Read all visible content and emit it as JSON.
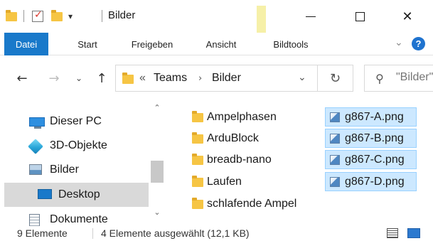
{
  "window": {
    "title": "Bilder",
    "contextual_tab_group": "Bildtools",
    "quick_access_dropdown": "▾",
    "controls": {
      "minimize": "—",
      "maximize": "☐",
      "close": "✕"
    }
  },
  "ribbon": {
    "tabs": [
      {
        "label": "Datei",
        "active": true
      },
      {
        "label": "Start"
      },
      {
        "label": "Freigeben"
      },
      {
        "label": "Ansicht"
      },
      {
        "label": "Bildtools"
      }
    ],
    "expand_chevron": "⌄",
    "help": "?"
  },
  "navigation": {
    "back": "←",
    "forward": "→",
    "recent": "⌄",
    "up": "↑"
  },
  "address_bar": {
    "overflow": "«",
    "segments": [
      "Teams",
      "Bilder"
    ],
    "separator": "›",
    "dropdown": "⌄",
    "refresh": "↻"
  },
  "search": {
    "icon": "search-icon",
    "placeholder": "\"Bilder\" durchsuchen"
  },
  "nav_pane": {
    "items": [
      {
        "label": "Dieser PC",
        "icon": "computer-icon"
      },
      {
        "label": "3D-Objekte",
        "icon": "3d-objects-icon"
      },
      {
        "label": "Bilder",
        "icon": "pictures-icon"
      },
      {
        "label": "Desktop",
        "icon": "desktop-icon",
        "selected": true
      },
      {
        "label": "Dokumente",
        "icon": "documents-icon"
      }
    ],
    "scroll_up": "⌃",
    "scroll_down": "⌄"
  },
  "content": {
    "folders": [
      {
        "name": "Ampelphasen"
      },
      {
        "name": "ArduBlock"
      },
      {
        "name": "breadb-nano"
      },
      {
        "name": "Laufen"
      },
      {
        "name": "schlafende Ampel"
      }
    ],
    "files": [
      {
        "name": "g867-A.png",
        "selected": true
      },
      {
        "name": "g867-B.png",
        "selected": true
      },
      {
        "name": "g867-C.png",
        "selected": true
      },
      {
        "name": "g867-D.png",
        "selected": true
      }
    ]
  },
  "status_bar": {
    "count": "9 Elemente",
    "selection": "4 Elemente ausgewählt (12,1 KB)"
  },
  "colors": {
    "accent": "#1979ca",
    "selection_bg": "#cce8ff",
    "selection_border": "#99d1ff",
    "nav_selected_bg": "#d9d9d9",
    "folder": "#f6c544",
    "contextual_tab": "#f6f0a8"
  }
}
